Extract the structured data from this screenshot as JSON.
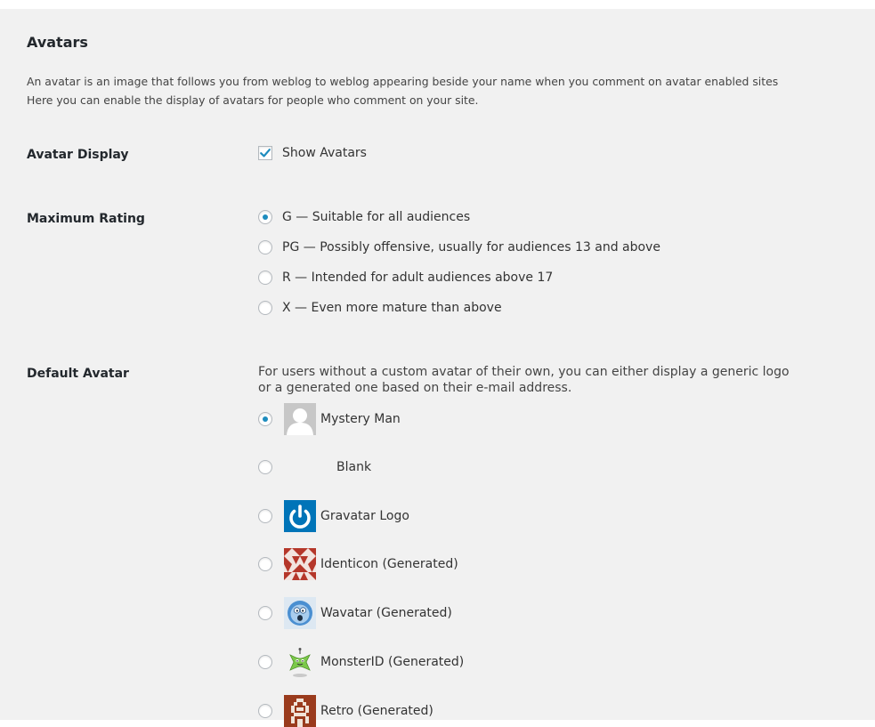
{
  "section": {
    "title": "Avatars",
    "intro": [
      "An avatar is an image that follows you from weblog to weblog appearing beside your name when you comment on avatar enabled sites",
      "Here you can enable the display of avatars for people who comment on your site."
    ]
  },
  "avatar_display": {
    "label": "Avatar Display",
    "checkbox_label": "Show Avatars",
    "checked": true
  },
  "maximum_rating": {
    "label": "Maximum Rating",
    "selected": "G",
    "options": [
      {
        "value": "G",
        "label": "G — Suitable for all audiences"
      },
      {
        "value": "PG",
        "label": "PG — Possibly offensive, usually for audiences 13 and above"
      },
      {
        "value": "R",
        "label": "R — Intended for adult audiences above 17"
      },
      {
        "value": "X",
        "label": "X — Even more mature than above"
      }
    ]
  },
  "default_avatar": {
    "label": "Default Avatar",
    "description": [
      "For users without a custom avatar of their own, you can either display a generic logo",
      "or a generated one based on their e-mail address."
    ],
    "selected": "mystery",
    "options": [
      {
        "value": "mystery",
        "label": "Mystery Man",
        "icon": "mystery-man-icon"
      },
      {
        "value": "blank",
        "label": "Blank",
        "icon": "blank-icon"
      },
      {
        "value": "gravatar_default",
        "label": "Gravatar Logo",
        "icon": "gravatar-logo-icon"
      },
      {
        "value": "identicon",
        "label": "Identicon (Generated)",
        "icon": "identicon-icon"
      },
      {
        "value": "wavatar",
        "label": "Wavatar (Generated)",
        "icon": "wavatar-icon"
      },
      {
        "value": "monsterid",
        "label": "MonsterID (Generated)",
        "icon": "monsterid-icon"
      },
      {
        "value": "retro",
        "label": "Retro (Generated)",
        "icon": "retro-icon"
      }
    ]
  },
  "colors": {
    "background": "#f1f1f1",
    "text": "#23282d",
    "accent": "#1e8cbe",
    "gravatar_blue": "#0074b8",
    "identicon_red": "#b5372a",
    "monster_green": "#7bc94a",
    "retro_brown": "#9a3b1d"
  }
}
